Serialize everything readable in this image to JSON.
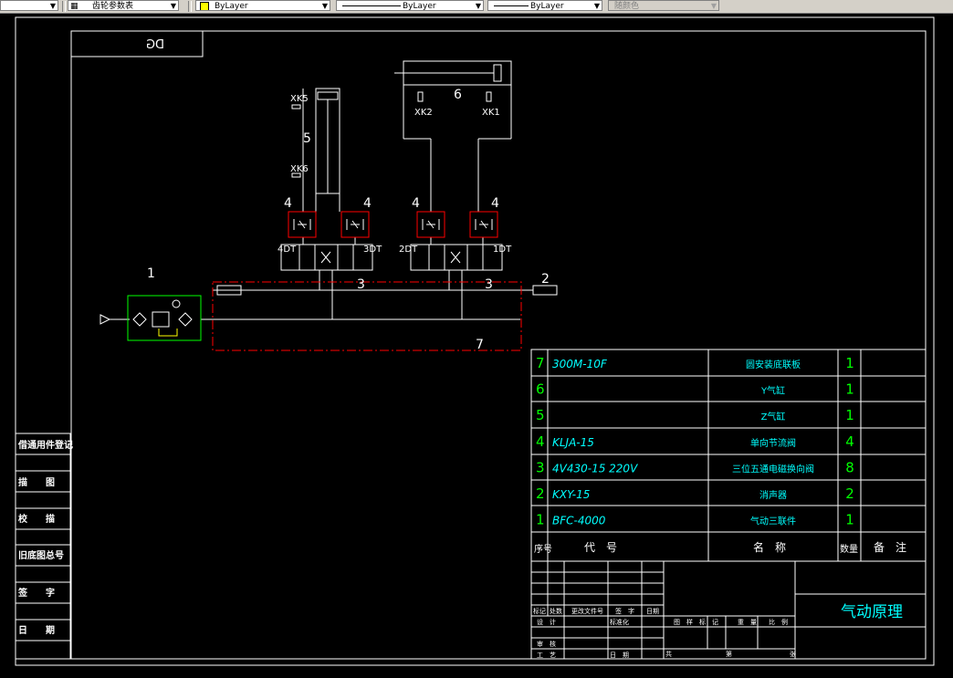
{
  "toolbar": {
    "table_style": "齿轮参数表",
    "color": "ByLayer",
    "linetype": "ByLayer",
    "lineweight": "ByLayer",
    "plotstyle": "随颜色"
  },
  "drawing": {
    "title_tab": "DG",
    "callouts": {
      "c1": "1",
      "c2": "2",
      "c3a": "3",
      "c3b": "3",
      "c4a": "4",
      "c4b": "4",
      "c4c": "4",
      "c4d": "4",
      "c5": "5",
      "c6": "6",
      "c7": "7"
    },
    "switches": {
      "xk1": "XK1",
      "xk2": "XK2",
      "xk5": "XK5",
      "xk6": "XK6"
    },
    "solenoids": {
      "dt1": "1DT",
      "dt2": "2DT",
      "dt3": "3DT",
      "dt4": "4DT"
    }
  },
  "left_panel": [
    "借通用件登记",
    "描　　图",
    "校　　描",
    "旧底图总号",
    "签　　字",
    "日　　期"
  ],
  "bom": {
    "rows": [
      {
        "no": "7",
        "code": "300M-10F",
        "name": "圆安装底联板",
        "qty": "1",
        "note": ""
      },
      {
        "no": "6",
        "code": "",
        "name": "Y气缸",
        "qty": "1",
        "note": ""
      },
      {
        "no": "5",
        "code": "",
        "name": "Z气缸",
        "qty": "1",
        "note": ""
      },
      {
        "no": "4",
        "code": "KLJA-15",
        "name": "单向节流阀",
        "qty": "4",
        "note": ""
      },
      {
        "no": "3",
        "code": "4V430-15  220V",
        "name": "三位五通电磁换向阀",
        "qty": "8",
        "note": ""
      },
      {
        "no": "2",
        "code": "KXY-15",
        "name": "消声器",
        "qty": "2",
        "note": ""
      },
      {
        "no": "1",
        "code": "BFC-4000",
        "name": "气动三联件",
        "qty": "1",
        "note": ""
      }
    ],
    "header": {
      "no": "序号",
      "code": "代　号",
      "name": "名　称",
      "qty": "数量",
      "note": "备　注"
    }
  },
  "title_block": {
    "title": "气动原理",
    "labels": {
      "marks": "标记",
      "count": "处数",
      "change_doc": "更改文件号",
      "sign": "签　字",
      "date": "日期",
      "design": "设　计",
      "standard": "标准化",
      "review": "审　核",
      "process": "工　艺",
      "date2": "日　期",
      "stage": "图　样　标　记",
      "weight": "重　量",
      "scale": "比　例",
      "sheet": "共",
      "page": "第",
      "zhang": "张"
    }
  },
  "colors": {
    "background": "#000000",
    "line": "#ffffff",
    "cyan": "#00ffff",
    "green": "#00ff00",
    "red": "#ff0000",
    "yellow": "#ffff00"
  }
}
